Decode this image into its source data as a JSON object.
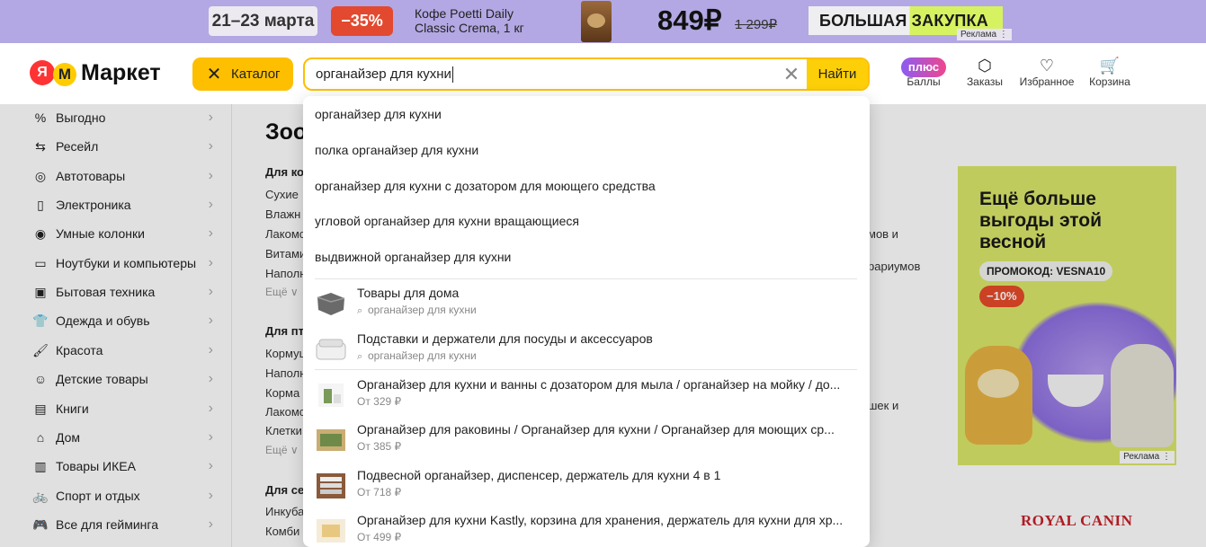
{
  "promo": {
    "dates": "21–23 марта",
    "discount": "−35%",
    "product_line1": "Кофе Poetti Daily",
    "product_line2": "Classic Crema, 1 кг",
    "price": "849₽",
    "old_price": "1 299₽",
    "big_buy": "БОЛЬШАЯ ЗАКУПКА",
    "ad_label": "Реклама ⋮"
  },
  "header": {
    "logo_ya": "Я",
    "logo_m": "М",
    "logo_name": "Маркет",
    "catalog_icon": "✕",
    "catalog_label": "Каталог",
    "search_value": "органайзер для кухни",
    "clear_icon": "✕",
    "search_button": "Найти",
    "nav": [
      {
        "icon": "плюс",
        "label": "Баллы"
      },
      {
        "icon": "⬡",
        "label": "Заказы"
      },
      {
        "icon": "♡",
        "label": "Избранное"
      },
      {
        "icon": "🛒",
        "label": "Корзина"
      }
    ]
  },
  "sidebar": {
    "items": [
      {
        "icon": "%",
        "label": "Выгодно"
      },
      {
        "icon": "⇆",
        "label": "Ресейл"
      },
      {
        "icon": "◎",
        "label": "Автотовары"
      },
      {
        "icon": "▯",
        "label": "Электроника"
      },
      {
        "icon": "◉",
        "label": "Умные колонки"
      },
      {
        "icon": "▭",
        "label": "Ноутбуки и компьютеры"
      },
      {
        "icon": "▣",
        "label": "Бытовая техника"
      },
      {
        "icon": "👕",
        "label": "Одежда и обувь"
      },
      {
        "icon": "🖌",
        "label": "Красота"
      },
      {
        "icon": "☺",
        "label": "Детские товары"
      },
      {
        "icon": "▤",
        "label": "Книги"
      },
      {
        "icon": "⌂",
        "label": "Дом"
      },
      {
        "icon": "▥",
        "label": "Товары ИКЕА"
      },
      {
        "icon": "🚲",
        "label": "Спорт и отдых"
      },
      {
        "icon": "🎮",
        "label": "Все для гейминга"
      }
    ],
    "arrow": "›"
  },
  "main": {
    "title": "Зоо",
    "group1_title": "Для ко",
    "group1_items": [
      "Сухие",
      "Влажн",
      "Лакомс",
      "Витами",
      "Наполн"
    ],
    "group1_more": "Ещё ∨",
    "group2_title": "Для пт",
    "group2_items": [
      "Кормуш",
      "Наполн",
      "Корма",
      "Лакомс",
      "Клетки"
    ],
    "group2_more": "Ещё ∨",
    "group3_title": "Для се",
    "group3_items": [
      "Инкуба",
      "Комби"
    ],
    "right_frag1": "мов и",
    "right_frag2": "рариумов",
    "right_frag3": "шек и"
  },
  "dropdown": {
    "suggestions": [
      "органайзер для кухни",
      "полка органайзер для кухни",
      "органайзер для кухни с дозатором для моющего средства",
      "угловой органайзер для кухни вращающиеся",
      "выдвижной органайзер для кухни"
    ],
    "categories": [
      {
        "title": "Товары для дома",
        "sub": "органайзер для кухни"
      },
      {
        "title": "Подставки и держатели для посуды и аксессуаров",
        "sub": "органайзер для кухни"
      }
    ],
    "products": [
      {
        "title": "Органайзер для кухни и ванны с дозатором для мыла / органайзер на мойку / до...",
        "price": "От 329 ₽"
      },
      {
        "title": "Органайзер для раковины / Органайзер для кухни / Органайзер для моющих ср...",
        "price": "От 385 ₽"
      },
      {
        "title": "Подвесной органайзер, диспенсер, держатель для кухни 4 в 1",
        "price": "От 718 ₽"
      },
      {
        "title": "Органайзер для кухни Kastly, корзина для хранения, держатель для кухни для хр...",
        "price": "От 499 ₽"
      }
    ]
  },
  "adcard": {
    "headline_1": "Ещё больше",
    "headline_2": "выгоды этой",
    "headline_3": "весной",
    "promo_code": "ПРОМОКОД: VESNA10",
    "percent": "−10%",
    "ad_label": "Реклама ⋮"
  },
  "brand": {
    "royal_canin": "ROYAL CANIN"
  }
}
